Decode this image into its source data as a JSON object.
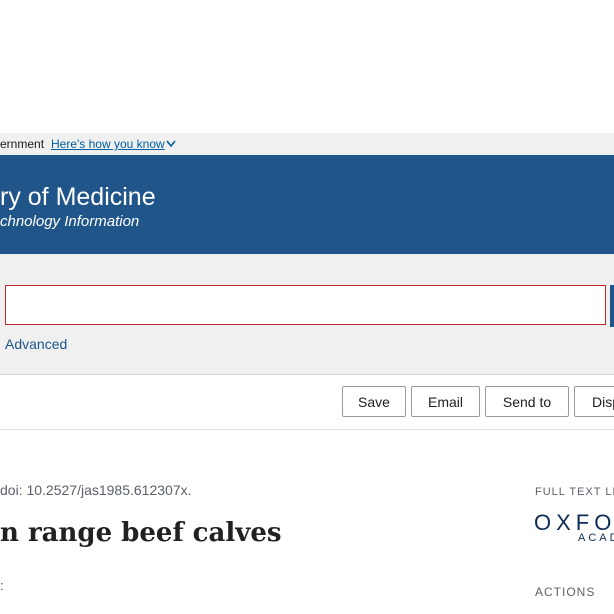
{
  "gov_banner": {
    "text": "ernment",
    "link_label": "Here's how you know",
    "chevron_icon": "chevron-down-icon"
  },
  "header": {
    "title": "ry of Medicine",
    "subtitle": "chnology Information"
  },
  "search": {
    "value": "",
    "advanced_label": "Advanced"
  },
  "actions": {
    "save_label": "Save",
    "email_label": "Email",
    "send_to_label": "Send to",
    "display_label": "Disp"
  },
  "article": {
    "citation": "doi: 10.2527/jas1985.612307x.",
    "title": "n range beef calves"
  },
  "sidebar": {
    "full_text_label": "FULL TEXT LIN",
    "publisher_logo_text": "OXFO",
    "publisher_logo_subtext": "ACAD",
    "actions_label": "ACTIONS"
  },
  "colors": {
    "header_bg": "#20558a",
    "banner_bg": "#f0f0f0",
    "search_border": "#c0272d",
    "link": "#005ea2"
  }
}
